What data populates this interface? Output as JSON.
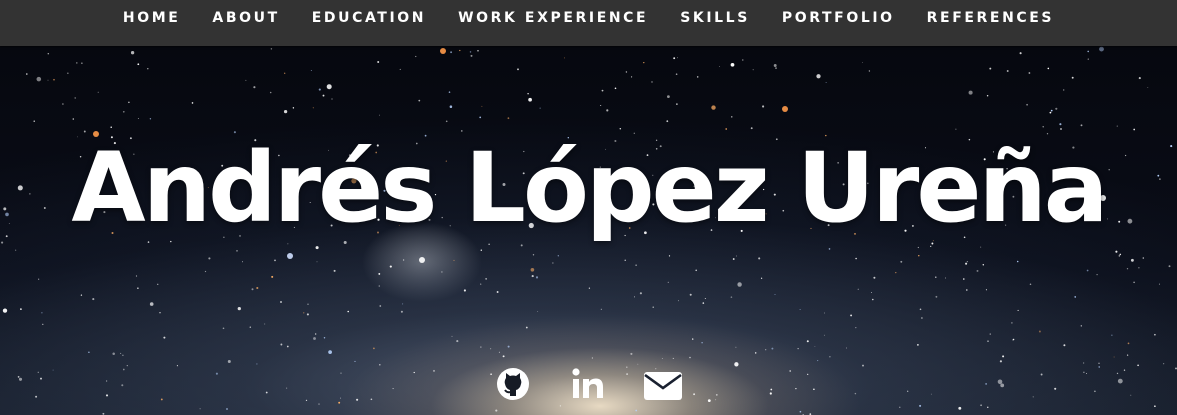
{
  "nav": {
    "items": [
      {
        "label": "HOME"
      },
      {
        "label": "ABOUT"
      },
      {
        "label": "EDUCATION"
      },
      {
        "label": "WORK EXPERIENCE"
      },
      {
        "label": "SKILLS"
      },
      {
        "label": "PORTFOLIO"
      },
      {
        "label": "REFERENCES"
      }
    ]
  },
  "hero": {
    "name": "Andrés López Ureña",
    "social": [
      {
        "icon": "github-icon"
      },
      {
        "icon": "linkedin-icon"
      },
      {
        "icon": "envelope-icon"
      }
    ]
  },
  "colors": {
    "nav_background": "#333333",
    "text": "#ffffff"
  }
}
